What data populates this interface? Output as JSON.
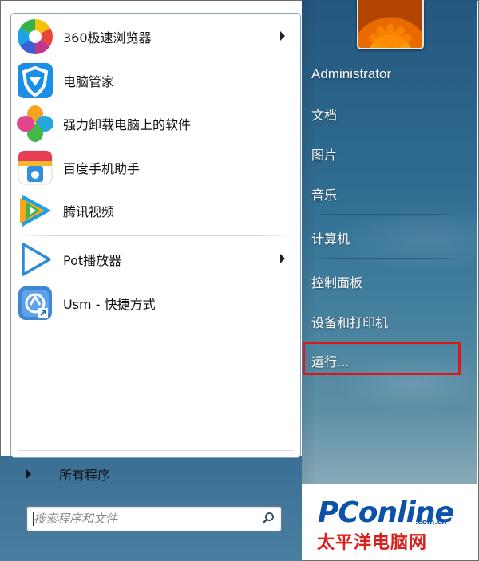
{
  "programs": [
    {
      "label": "360极速浏览器",
      "icon": "360-browser-icon",
      "has_submenu": true
    },
    {
      "label": "电脑管家",
      "icon": "pc-manager-shield-icon",
      "has_submenu": false
    },
    {
      "label": "强力卸载电脑上的软件",
      "icon": "uninstaller-clover-icon",
      "has_submenu": false
    },
    {
      "label": "百度手机助手",
      "icon": "baidu-phone-assistant-icon",
      "has_submenu": false
    },
    {
      "label": "腾讯视频",
      "icon": "tencent-video-icon",
      "has_submenu": false
    },
    {
      "label": "Pot播放器",
      "icon": "pot-player-icon",
      "has_submenu": true
    },
    {
      "label": "Usm - 快捷方式",
      "icon": "usm-shortcut-icon",
      "has_submenu": false
    }
  ],
  "all_programs": "所有程序",
  "search": {
    "placeholder": "搜索程序和文件"
  },
  "right_menu": {
    "user": "Administrator",
    "items": [
      "文档",
      "图片",
      "音乐",
      "计算机",
      "控制面板",
      "设备和打印机",
      "运行..."
    ]
  },
  "highlighted_item": "运行...",
  "colors": {
    "highlight": "#d91919",
    "panel": "#2e6a90"
  },
  "watermark": {
    "brand": "PConline",
    "domain": ".com.cn",
    "cn": "太平洋电脑网"
  }
}
